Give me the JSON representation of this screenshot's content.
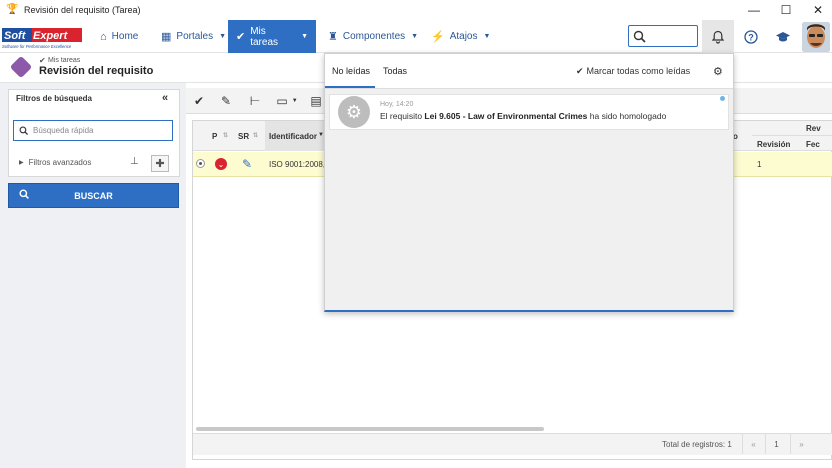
{
  "window": {
    "title": "Revisión del requisito (Tarea)",
    "minimize": "—",
    "maximize": "☐",
    "close": "✕"
  },
  "logo": {
    "brand": "SoftExpert",
    "tagline": "Software for Performance Excellence"
  },
  "nav": {
    "home": "Home",
    "portales": "Portales",
    "mis_tareas": "Mis tareas",
    "componentes": "Componentes",
    "atajos": "Atajos"
  },
  "breadcrumb": {
    "parent": "Mis tareas",
    "title": "Revisión del requisito"
  },
  "filters": {
    "header": "Filtros de búsqueda",
    "quick_search_placeholder": "Búsqueda rápida",
    "advanced": "Filtros avanzados",
    "search_button": "BUSCAR"
  },
  "grid": {
    "headers": {
      "p": "P",
      "sr": "SR",
      "identificador": "Identificador",
      "revision": "Revisión",
      "rev_group": "Rev",
      "fecha": "Fec",
      "partial_o": "o"
    },
    "rows": [
      {
        "identificador": "ISO 9001:2008,",
        "revision": "1"
      }
    ],
    "total": "Total de registros: 1",
    "pager": {
      "first": "«",
      "page": "1",
      "last": "»"
    }
  },
  "notifications": {
    "tab_unread": "No leídas",
    "tab_all": "Todas",
    "mark_all": "Marcar todas como leídas",
    "items": [
      {
        "time": "Hoy, 14:20",
        "prefix": "El requisito ",
        "bold": "Lei 9.605 - Law of Environmental Crimes",
        "suffix": " ha sido homologado"
      }
    ]
  },
  "colors": {
    "accent": "#2e6fc4",
    "row_highlight": "#fdfbd0",
    "status_red": "#d9232e"
  }
}
